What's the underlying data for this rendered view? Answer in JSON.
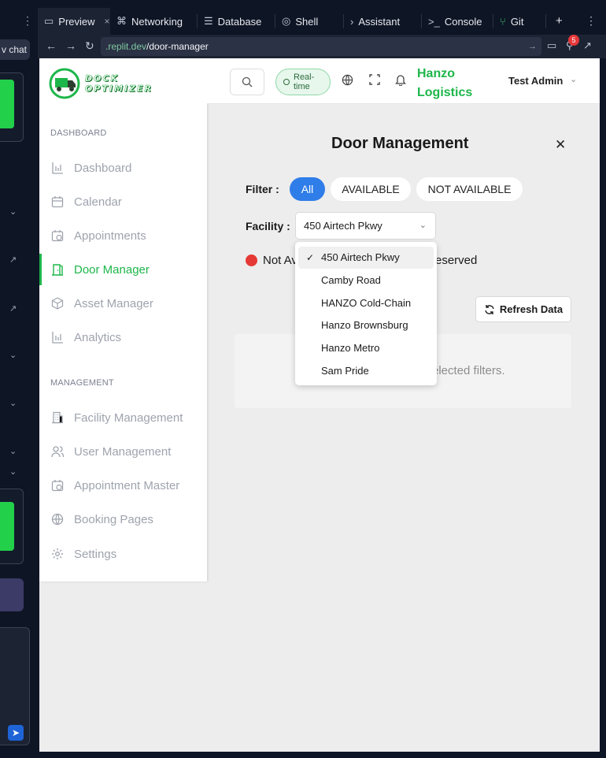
{
  "ide": {
    "new_chat_label": "v chat",
    "tabs": [
      {
        "label": "Preview",
        "icon": "monitor-icon",
        "active": true
      },
      {
        "label": "Networking",
        "icon": "network-icon"
      },
      {
        "label": "Database",
        "icon": "database-icon"
      },
      {
        "label": "Shell",
        "icon": "shell-icon"
      },
      {
        "label": "Assistant",
        "icon": "assistant-icon"
      },
      {
        "label": "Console",
        "icon": "console-icon"
      },
      {
        "label": "Git",
        "icon": "git-icon"
      }
    ],
    "url_host": ".replit.dev",
    "url_path": "/door-manager",
    "notification_count": "5"
  },
  "app": {
    "logo_line1": "DOCK",
    "logo_line2": "OPTIMIZER",
    "sections": {
      "dashboard": "DASHBOARD",
      "management": "MANAGEMENT"
    },
    "nav": {
      "dashboard": "Dashboard",
      "calendar": "Calendar",
      "appointments": "Appointments",
      "door_manager": "Door Manager",
      "asset_manager": "Asset Manager",
      "analytics": "Analytics",
      "facility_management": "Facility Management",
      "user_management": "User Management",
      "appointment_master": "Appointment Master",
      "booking_pages": "Booking Pages",
      "settings": "Settings"
    },
    "topbar": {
      "realtime_line1": "Real-",
      "realtime_line2": "time",
      "company_line1": "Hanzo",
      "company_line2": "Logistics",
      "user_name": "Test Admin"
    },
    "modal": {
      "title": "Door Management",
      "filter_label": "Filter :",
      "filters": {
        "all": "All",
        "available": "AVAILABLE",
        "not_available": "NOT AVAILABLE"
      },
      "facility_label": "Facility :",
      "facility_selected": "450 Airtech Pkwy",
      "legend_not_available": "Not Av",
      "legend_reserved": "eserved",
      "refresh_label": "Refresh Data",
      "empty_text": "elected filters."
    },
    "dropdown_options": [
      "450 Airtech Pkwy",
      "Camby Road",
      "HANZO Cold-Chain",
      "Hanzo Brownsburg",
      "Hanzo Metro",
      "Sam Pride"
    ]
  },
  "colors": {
    "brand_green": "#1db64a",
    "filter_active_blue": "#2f7de8",
    "not_available_red": "#e53935"
  }
}
